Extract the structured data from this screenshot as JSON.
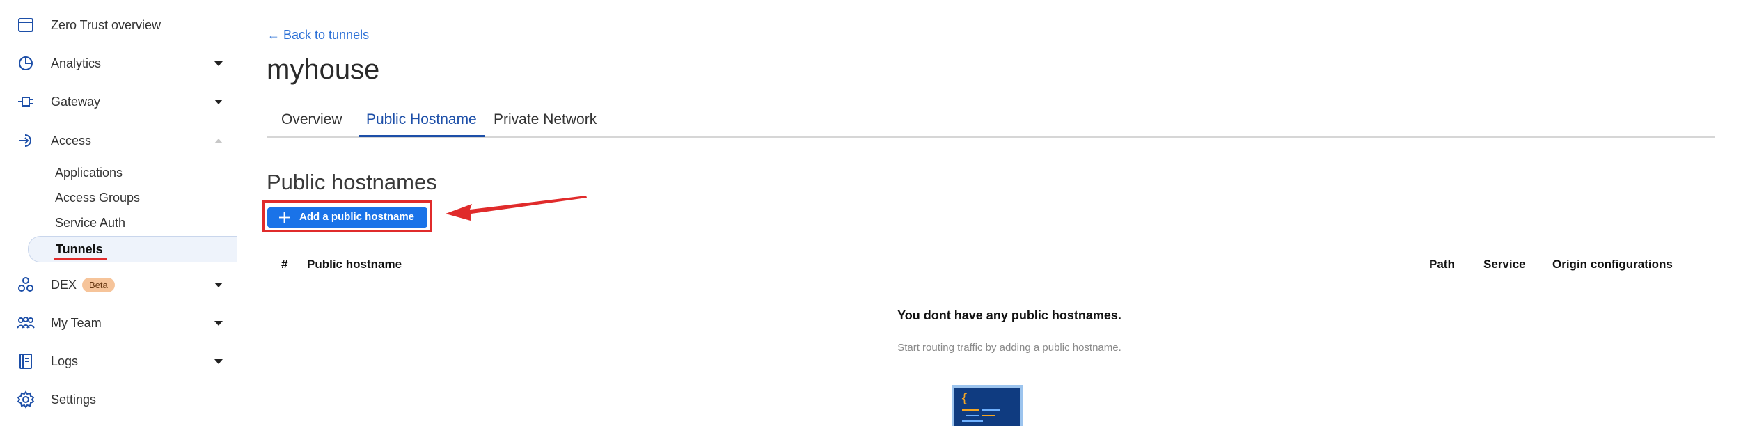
{
  "sidebar": {
    "items": [
      {
        "label": "Zero Trust overview",
        "icon": "browser-window-icon"
      },
      {
        "label": "Analytics",
        "icon": "pie-chart-icon"
      },
      {
        "label": "Gateway",
        "icon": "gateway-icon"
      },
      {
        "label": "Access",
        "icon": "access-icon"
      },
      {
        "label": "DEX",
        "icon": "dex-icon",
        "badge": "Beta"
      },
      {
        "label": "My Team",
        "icon": "team-icon"
      },
      {
        "label": "Logs",
        "icon": "logs-icon"
      },
      {
        "label": "Settings",
        "icon": "gear-icon"
      }
    ],
    "access_subitems": [
      "Applications",
      "Access Groups",
      "Service Auth",
      "Tunnels"
    ]
  },
  "main": {
    "back_link": "← Back to tunnels",
    "title": "myhouse",
    "tabs": [
      "Overview",
      "Public Hostname",
      "Private Network"
    ],
    "active_tab": "Public Hostname",
    "section_title": "Public hostnames",
    "add_button": "Add a public hostname",
    "table_headers": [
      "#",
      "Public hostname",
      "Path",
      "Service",
      "Origin configurations"
    ],
    "empty_title": "You dont have any public hostnames.",
    "empty_subtitle": "Start routing traffic by adding a public hostname."
  },
  "colors": {
    "accent": "#1d4fa8",
    "button": "#1a73e8",
    "annotation_red": "#e02b2b",
    "beta_badge": "#f6c49a"
  }
}
